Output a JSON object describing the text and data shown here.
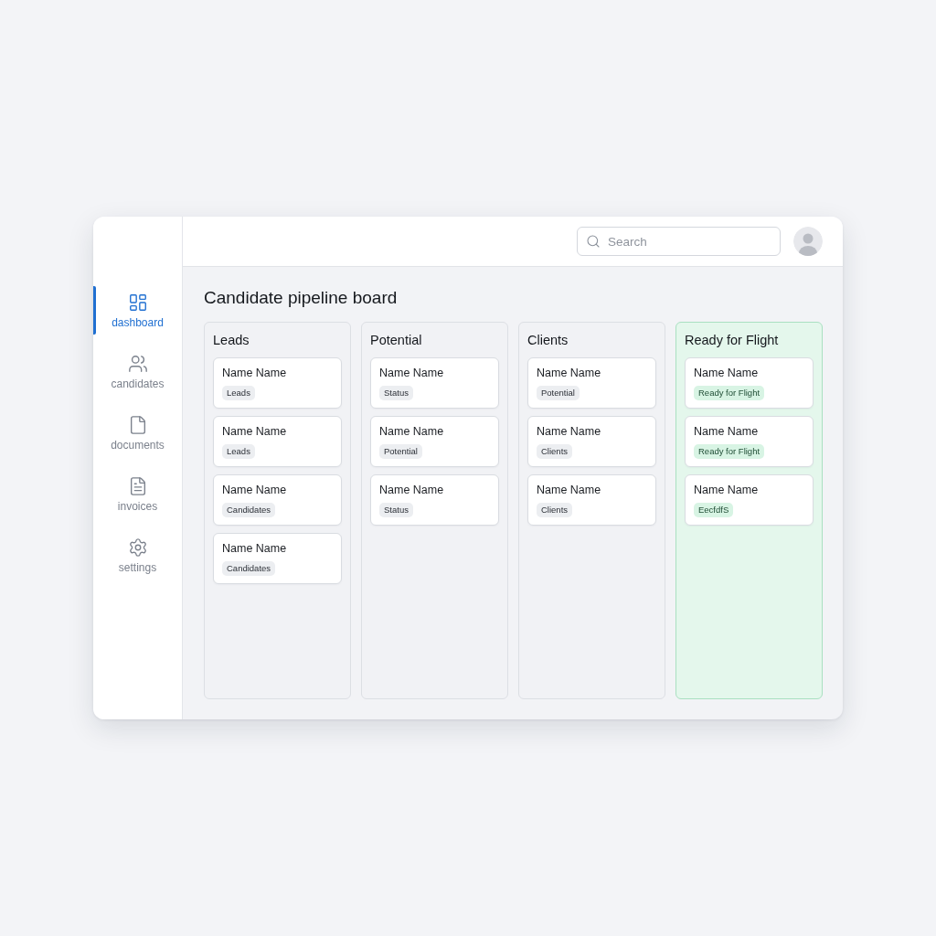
{
  "sidebar": {
    "items": [
      {
        "label": "dashboard",
        "selected": true
      },
      {
        "label": "candidates",
        "selected": false
      },
      {
        "label": "documents",
        "selected": false
      },
      {
        "label": "invoices",
        "selected": false
      },
      {
        "label": "settings",
        "selected": false
      }
    ]
  },
  "topbar": {
    "search": {
      "placeholder": "Search"
    }
  },
  "board": {
    "title": "Candidate pipeline board",
    "columns": [
      {
        "title": "Leads",
        "highlighted": false,
        "cards": [
          {
            "name": "Name Name",
            "tag": "Leads"
          },
          {
            "name": "Name Name",
            "tag": "Leads"
          },
          {
            "name": "Name Name",
            "tag": "Candidates"
          },
          {
            "name": "Name Name",
            "tag": "Candidates"
          }
        ]
      },
      {
        "title": "Potential",
        "highlighted": false,
        "cards": [
          {
            "name": "Name Name",
            "tag": "Status"
          },
          {
            "name": "Name Name",
            "tag": "Potential"
          },
          {
            "name": "Name Name",
            "tag": "Status"
          }
        ]
      },
      {
        "title": "Clients",
        "highlighted": false,
        "cards": [
          {
            "name": "Name Name",
            "tag": "Potential"
          },
          {
            "name": "Name Name",
            "tag": "Clients"
          },
          {
            "name": "Name Name",
            "tag": "Clients"
          }
        ]
      },
      {
        "title": "Ready for Flight",
        "highlighted": true,
        "cards": [
          {
            "name": "Name Name",
            "tag": "Ready for Flight"
          },
          {
            "name": "Name Name",
            "tag": "Ready for Flight"
          },
          {
            "name": "Name Name",
            "tag": "EecfdfS"
          }
        ]
      }
    ]
  }
}
